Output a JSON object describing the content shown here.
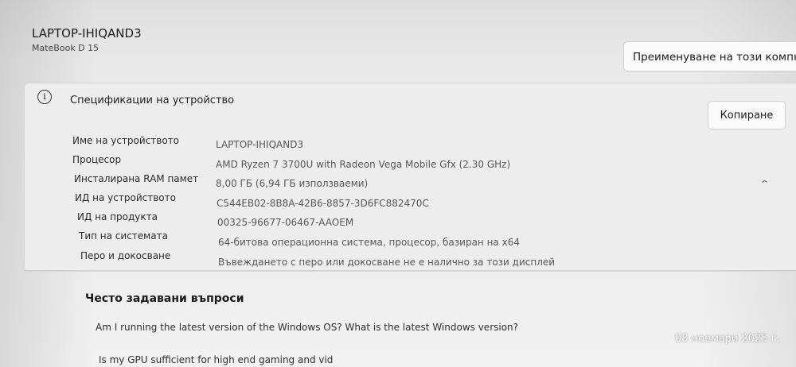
{
  "device": {
    "name": "LAPTOP-IHIQAND3",
    "model": "MateBook D 15"
  },
  "rename_button": "Преименуване на този компют",
  "specs_section": {
    "icon": "info-icon",
    "title": "Спецификации на устройство",
    "copy_button": "Копиране",
    "rows": [
      {
        "label": "Име на устройството",
        "value": "LAPTOP-IHIQAND3"
      },
      {
        "label": "Процесор",
        "value": "AMD Ryzen 7 3700U with Radeon Vega Mobile Gfx   (2.30 GHz)"
      },
      {
        "label": "Инсталирана RAM памет",
        "value": "8,00 ГБ (6,94 ГБ използваеми)"
      },
      {
        "label": "ИД на устройството",
        "value": "C544EB02-8B8A-42B6-8857-3D6FC882470C"
      },
      {
        "label": "ИД на продукта",
        "value": "00325-96677-06467-AAOEM"
      },
      {
        "label": "Тип на системата",
        "value": "64-битова операционна система, процесор, базиран на x64"
      },
      {
        "label": "Перо и докосване",
        "value": "Въвеждането с перо или докосване не е налично за този дисплей"
      }
    ]
  },
  "faq": {
    "title": "Често задавани въпроси",
    "questions": [
      "Am I running the latest version of the Windows OS? What is the latest Windows version?",
      "Is my GPU sufficient for high end gaming and vid"
    ]
  },
  "timestamp": "08 ноември 2025 г."
}
